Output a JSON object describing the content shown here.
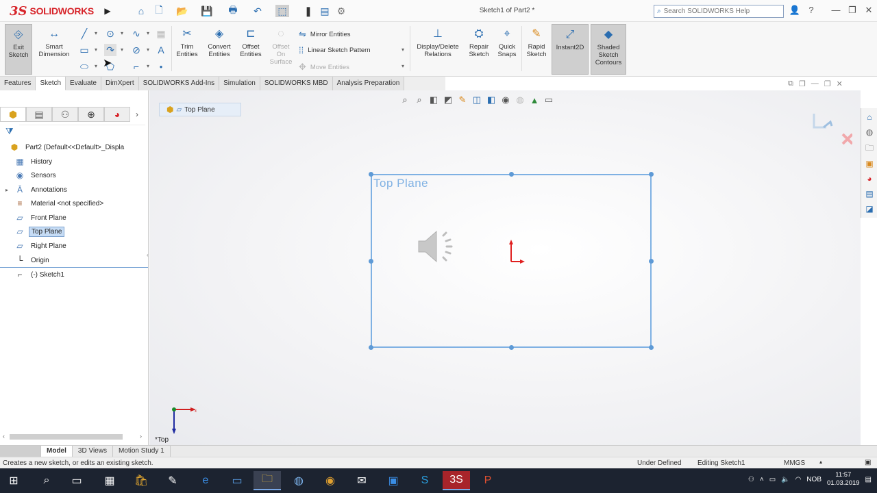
{
  "app": {
    "logo_ds": "3S",
    "logo_name": "SOLIDWORKS",
    "doc_title": "Sketch1 of Part2 *",
    "search_placeholder": "Search SOLIDWORKS Help"
  },
  "toolbar": {
    "exit_sketch": "Exit Sketch",
    "smart_dimension": "Smart Dimension",
    "trim_entities": "Trim Entities",
    "convert_entities": "Convert Entities",
    "offset_entities": "Offset Entities",
    "offset_on_surface": "Offset On Surface",
    "mirror_entities": "Mirror Entities",
    "linear_sketch_pattern": "Linear Sketch Pattern",
    "move_entities": "Move Entities",
    "display_delete_relations": "Display/Delete Relations",
    "repair_sketch": "Repair Sketch",
    "quick_snaps": "Quick Snaps",
    "rapid_sketch": "Rapid Sketch",
    "instant2d": "Instant2D",
    "shaded_sketch_contours": "Shaded Sketch Contours"
  },
  "tabs": [
    "Features",
    "Sketch",
    "Evaluate",
    "DimXpert",
    "SOLIDWORKS Add-Ins",
    "Simulation",
    "SOLIDWORKS MBD",
    "Analysis Preparation"
  ],
  "active_tab": "Sketch",
  "tree": {
    "root": "Part2  (Default<<Default>_Displa",
    "items": [
      {
        "label": "History",
        "icon": "history-icon"
      },
      {
        "label": "Sensors",
        "icon": "sensors-icon"
      },
      {
        "label": "Annotations",
        "icon": "annotations-icon"
      },
      {
        "label": "Material <not specified>",
        "icon": "material-icon"
      },
      {
        "label": "Front Plane",
        "icon": "plane-icon"
      },
      {
        "label": "Top Plane",
        "icon": "plane-icon"
      },
      {
        "label": "Right Plane",
        "icon": "plane-icon"
      },
      {
        "label": "Origin",
        "icon": "origin-icon"
      },
      {
        "label": "(-) Sketch1",
        "icon": "sketch-icon"
      }
    ]
  },
  "graphics": {
    "breadcrumb": "Top Plane",
    "plane_label": "Top Plane",
    "view_label": "*Top",
    "triad_x": "x"
  },
  "bottom_tabs": [
    "Model",
    "3D Views",
    "Motion Study 1"
  ],
  "status": {
    "hint": "Creates a new sketch, or edits an existing sketch.",
    "state": "Under Defined",
    "editing": "Editing Sketch1",
    "units": "MMGS"
  },
  "taskbar": {
    "lang": "NOB",
    "time": "11:57",
    "date": "01.03.2019"
  },
  "colors": {
    "brand": "#d7242a",
    "plane": "#7fb1e3",
    "selection": "#c6dcf5"
  }
}
